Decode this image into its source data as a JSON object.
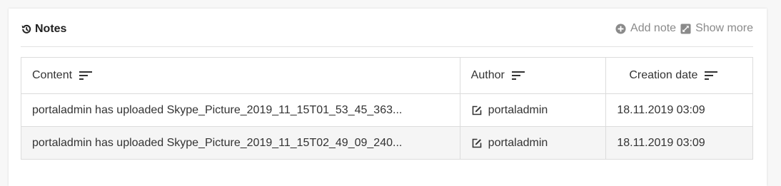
{
  "panel": {
    "title": "Notes",
    "title_icon": "history-icon",
    "actions": [
      {
        "label": "Add note",
        "icon": "plus-circle-icon"
      },
      {
        "label": "Show more",
        "icon": "expand-icon"
      }
    ]
  },
  "table": {
    "columns": [
      {
        "label": "Content",
        "icon": "sort-icon"
      },
      {
        "label": "Author",
        "icon": "sort-icon"
      },
      {
        "label": "Creation date",
        "icon": "sort-icon"
      }
    ],
    "rows": [
      {
        "content": "portaladmin has uploaded Skype_Picture_2019_11_15T01_53_45_363...",
        "author": "portaladmin",
        "author_icon": "edit-icon",
        "date": "18.11.2019 03:09"
      },
      {
        "content": "portaladmin has uploaded Skype_Picture_2019_11_15T02_49_09_240...",
        "author": "portaladmin",
        "author_icon": "edit-icon",
        "date": "18.11.2019 03:09"
      }
    ]
  },
  "colors": {
    "border": "#dcdcdc",
    "stripe": "#f5f5f5",
    "muted_text": "#8a8a8a",
    "text": "#333333"
  }
}
